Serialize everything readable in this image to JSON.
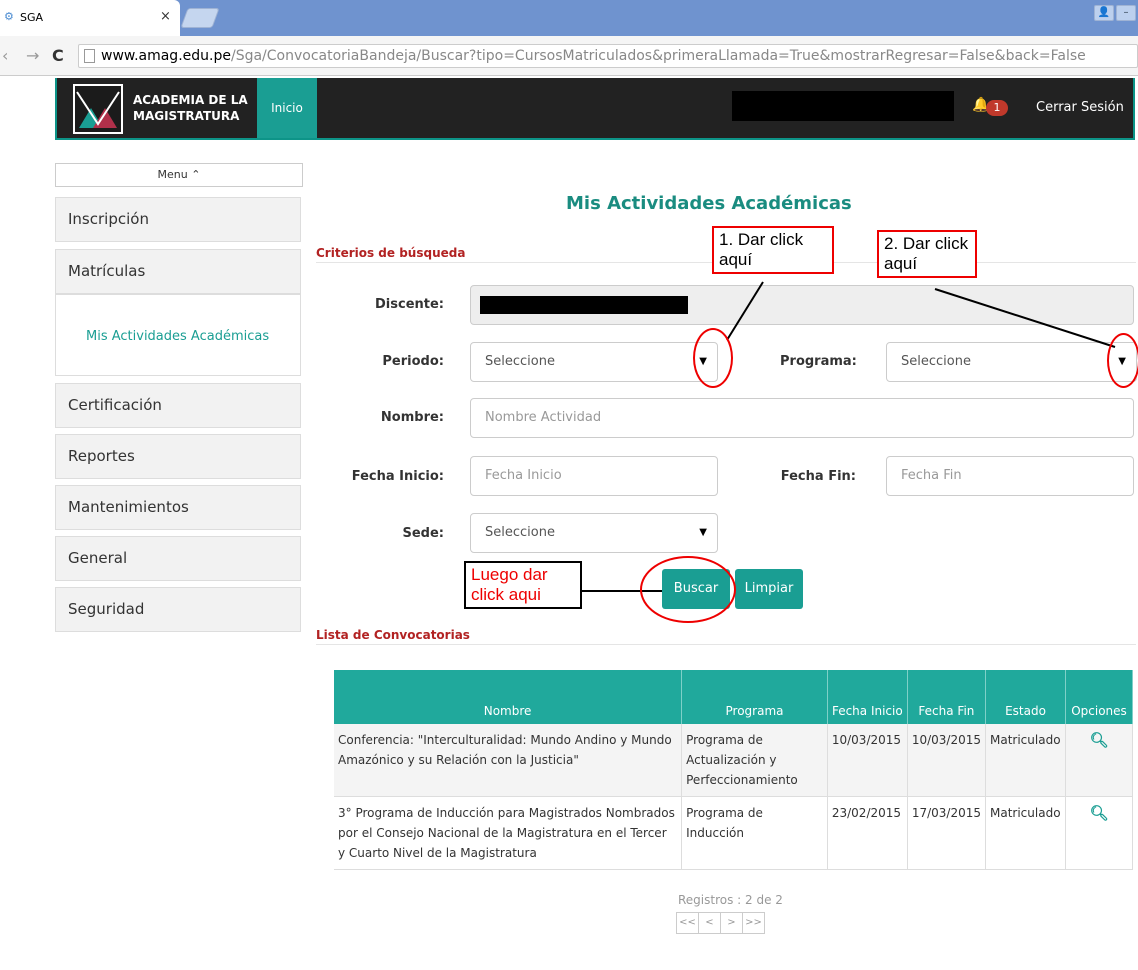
{
  "browser": {
    "tab_favicon": "SGA favicon",
    "tab_title": "SGA",
    "tab_close": "×",
    "url_host": "www.amag.edu.pe",
    "url_path": "/Sga/ConvocatoriaBandeja/Buscar?tipo=CursosMatriculados&primeraLlamada=True&mostrarRegresar=False&back=False"
  },
  "navbar": {
    "brand_line1": "ACADEMIA DE LA",
    "brand_line2": "MAGISTRATURA",
    "inicio": "Inicio",
    "badge": "1",
    "logout": "Cerrar Sesión"
  },
  "sidebar": {
    "menu_toggle": "Menu ⌃",
    "items": [
      "Inscripción",
      "Matrículas",
      "Certificación",
      "Reportes",
      "Mantenimientos",
      "General",
      "Seguridad"
    ],
    "sub_item": "Mis Actividades Académicas"
  },
  "main": {
    "title": "Mis Actividades Académicas",
    "criteria_title": "Criterios de búsqueda",
    "list_title": "Lista de Convocatorias"
  },
  "form": {
    "discente_label": "Discente:",
    "periodo_label": "Periodo:",
    "periodo_value": "Seleccione",
    "programa_label": "Programa:",
    "programa_value": "Seleccione",
    "nombre_label": "Nombre:",
    "nombre_placeholder": "Nombre Actividad",
    "fecha_inicio_label": "Fecha Inicio:",
    "fecha_inicio_placeholder": "Fecha Inicio",
    "fecha_fin_label": "Fecha Fin:",
    "fecha_fin_placeholder": "Fecha Fin",
    "sede_label": "Sede:",
    "sede_value": "Seleccione",
    "buscar": "Buscar",
    "limpiar": "Limpiar"
  },
  "annotations": {
    "note1": "1. Dar click aquí",
    "note2": "2. Dar click aquí",
    "note3": "Luego dar click aqui"
  },
  "table": {
    "headers": [
      "Nombre",
      "Programa",
      "Fecha Inicio",
      "Fecha Fin",
      "Estado",
      "Opciones"
    ],
    "rows": [
      [
        "Conferencia: \"Interculturalidad: Mundo Andino y Mundo Amazónico y su Relación con la Justicia\"",
        "Programa de Actualización y Perfeccionamiento",
        "10/03/2015",
        "10/03/2015",
        "Matriculado"
      ],
      [
        "3° Programa de Inducción para Magistrados Nombrados por el Consejo Nacional de la Magistratura en el Tercer y Cuarto Nivel de la Magistratura",
        "Programa de Inducción",
        "23/02/2015",
        "17/03/2015",
        "Matriculado"
      ]
    ]
  },
  "pagination": {
    "registros": "Registros : 2 de 2",
    "first": "<<",
    "prev": "<",
    "next": ">",
    "last": ">>"
  },
  "colors": {
    "accent": "#1a9e93",
    "navbar": "#222222",
    "annotation_red": "#e00000"
  }
}
